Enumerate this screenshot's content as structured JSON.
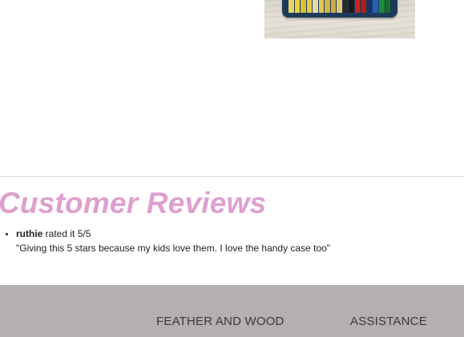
{
  "reviews": {
    "heading": "Customer Reviews",
    "items": [
      {
        "reviewer": "ruthie",
        "rating_text": " rated it 5/5",
        "quote": "\"Giving this 5 stars because my kids love them. I love the handy case too\""
      }
    ]
  },
  "footer": {
    "brand_heading": "FEATHER AND WOOD",
    "assistance_heading": "ASSISTANCE",
    "background_color": "#b5b0af"
  },
  "colors": {
    "heading_accent": "#dea0cf"
  },
  "product_image": {
    "crayon_colors": [
      "#e7d36a",
      "#e9d23f",
      "#d9c236",
      "#e8c94a",
      "#e4d9a8",
      "#e2c45c",
      "#d4b448",
      "#c8ad4b",
      "#e0c86a",
      "#2a2a2a",
      "#1a1a1a",
      "#c6251f",
      "#b01d1a",
      "#1c2f6b",
      "#1f5fb8",
      "#1e8a3a",
      "#1c6e2f"
    ]
  }
}
